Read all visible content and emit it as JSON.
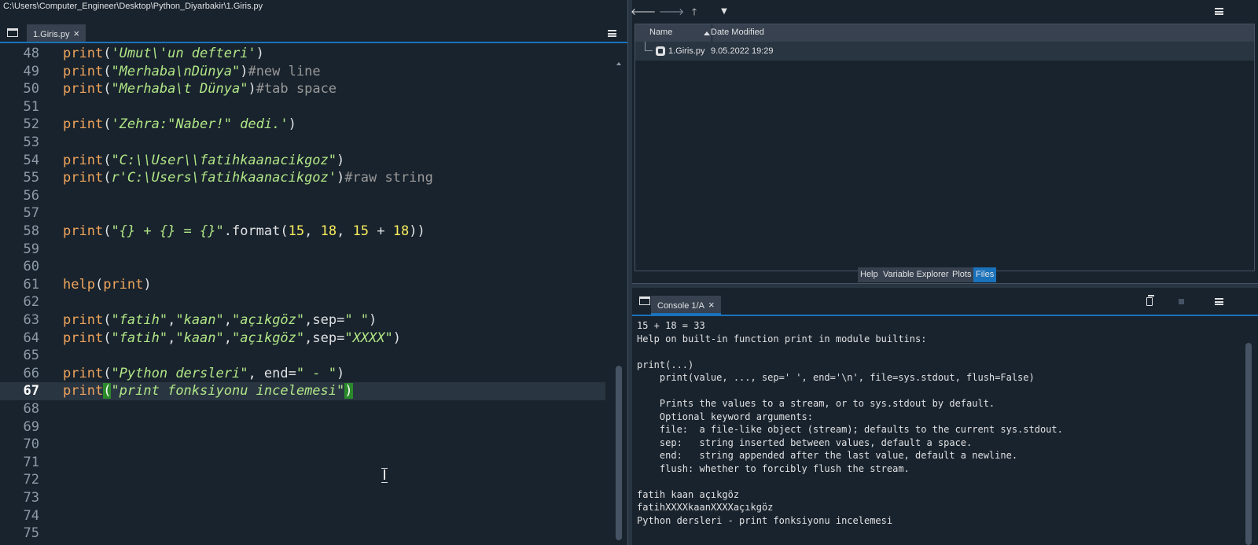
{
  "window": {
    "path": "C:\\Users\\Computer_Engineer\\Desktop\\Python_Diyarbakir\\1.Giris.py"
  },
  "editor": {
    "tab_label": "1.Giris.py",
    "tab_close": "×",
    "current_line": "67",
    "lines": [
      {
        "n": "48",
        "tokens": [
          [
            "fn",
            "print"
          ],
          [
            "op",
            "("
          ],
          [
            "st",
            "'Umut\\'un defteri'"
          ],
          [
            "op",
            ")"
          ]
        ]
      },
      {
        "n": "49",
        "tokens": [
          [
            "fn",
            "print"
          ],
          [
            "op",
            "("
          ],
          [
            "st",
            "\"Merhaba\\nDünya\""
          ],
          [
            "op",
            ")"
          ],
          [
            "cm",
            "#new line"
          ]
        ]
      },
      {
        "n": "50",
        "tokens": [
          [
            "fn",
            "print"
          ],
          [
            "op",
            "("
          ],
          [
            "st",
            "\"Merhaba\\t Dünya\""
          ],
          [
            "op",
            ")"
          ],
          [
            "cm",
            "#tab space"
          ]
        ]
      },
      {
        "n": "51",
        "tokens": []
      },
      {
        "n": "52",
        "tokens": [
          [
            "fn",
            "print"
          ],
          [
            "op",
            "("
          ],
          [
            "st",
            "'Zehra:\"Naber!\" dedi.'"
          ],
          [
            "op",
            ")"
          ]
        ]
      },
      {
        "n": "53",
        "tokens": []
      },
      {
        "n": "54",
        "tokens": [
          [
            "fn",
            "print"
          ],
          [
            "op",
            "("
          ],
          [
            "st",
            "\"C:\\\\User\\\\fatihkaanacikgoz\""
          ],
          [
            "op",
            ")"
          ]
        ]
      },
      {
        "n": "55",
        "tokens": [
          [
            "fn",
            "print"
          ],
          [
            "op",
            "("
          ],
          [
            "st",
            "r'C:\\Users\\fatihkaanacikgoz'"
          ],
          [
            "op",
            ")"
          ],
          [
            "cm",
            "#raw string"
          ]
        ]
      },
      {
        "n": "56",
        "tokens": []
      },
      {
        "n": "57",
        "tokens": []
      },
      {
        "n": "58",
        "tokens": [
          [
            "fn",
            "print"
          ],
          [
            "op",
            "("
          ],
          [
            "st",
            "\"{} + {} = {}\""
          ],
          [
            "op",
            ".format("
          ],
          [
            "nm",
            "15"
          ],
          [
            "op",
            ", "
          ],
          [
            "nm",
            "18"
          ],
          [
            "op",
            ", "
          ],
          [
            "nm",
            "15"
          ],
          [
            "op",
            " + "
          ],
          [
            "nm",
            "18"
          ],
          [
            "op",
            "))"
          ]
        ]
      },
      {
        "n": "59",
        "tokens": []
      },
      {
        "n": "60",
        "tokens": []
      },
      {
        "n": "61",
        "tokens": [
          [
            "fn",
            "help"
          ],
          [
            "op",
            "("
          ],
          [
            "fn",
            "print"
          ],
          [
            "op",
            ")"
          ]
        ]
      },
      {
        "n": "62",
        "tokens": []
      },
      {
        "n": "63",
        "tokens": [
          [
            "fn",
            "print"
          ],
          [
            "op",
            "("
          ],
          [
            "st",
            "\"fatih\""
          ],
          [
            "op",
            ","
          ],
          [
            "st",
            "\"kaan\""
          ],
          [
            "op",
            ","
          ],
          [
            "st",
            "\"açıkgöz\""
          ],
          [
            "op",
            ",sep="
          ],
          [
            "st",
            "\" \""
          ],
          [
            "op",
            ")"
          ]
        ]
      },
      {
        "n": "64",
        "tokens": [
          [
            "fn",
            "print"
          ],
          [
            "op",
            "("
          ],
          [
            "st",
            "\"fatih\""
          ],
          [
            "op",
            ","
          ],
          [
            "st",
            "\"kaan\""
          ],
          [
            "op",
            ","
          ],
          [
            "st",
            "\"açıkgöz\""
          ],
          [
            "op",
            ",sep="
          ],
          [
            "st",
            "\"XXXX\""
          ],
          [
            "op",
            ")"
          ]
        ]
      },
      {
        "n": "65",
        "tokens": []
      },
      {
        "n": "66",
        "tokens": [
          [
            "fn",
            "print"
          ],
          [
            "op",
            "("
          ],
          [
            "st",
            "\"Python dersleri\""
          ],
          [
            "op",
            ", end="
          ],
          [
            "st",
            "\" - \""
          ],
          [
            "op",
            ")"
          ]
        ]
      },
      {
        "n": "67",
        "tokens": [
          [
            "fn",
            "print"
          ],
          [
            "br",
            "("
          ],
          [
            "st",
            "\"print fonksiyonu incelemesi\""
          ],
          [
            "br",
            ")"
          ]
        ]
      },
      {
        "n": "68",
        "tokens": []
      },
      {
        "n": "69",
        "tokens": []
      },
      {
        "n": "70",
        "tokens": []
      },
      {
        "n": "71",
        "tokens": []
      },
      {
        "n": "72",
        "tokens": []
      },
      {
        "n": "73",
        "tokens": []
      },
      {
        "n": "74",
        "tokens": []
      },
      {
        "n": "75",
        "tokens": []
      }
    ]
  },
  "files": {
    "toolbar_icons": [
      "back-arrow-icon",
      "forward-arrow-icon",
      "parent-directory-icon",
      "filter-icon",
      "options-menu-icon"
    ],
    "toolbar_glyphs": {
      "back": "🡐",
      "forward": "🡒",
      "up": "🡑",
      "filter": "▼"
    },
    "columns": {
      "name": "Name",
      "date": "Date Modified"
    },
    "rows": [
      {
        "name": "1.Giris.py",
        "date": "9.05.2022 19:29"
      }
    ]
  },
  "bottom_tabs": [
    {
      "label": "Help",
      "active": false
    },
    {
      "label": "Variable Explorer",
      "active": false
    },
    {
      "label": "Plots",
      "active": false
    },
    {
      "label": "Files",
      "active": true
    }
  ],
  "console": {
    "tab_label": "Console 1/A",
    "tab_close": "×",
    "output": "15 + 18 = 33\nHelp on built-in function print in module builtins:\n\nprint(...)\n    print(value, ..., sep=' ', end='\\n', file=sys.stdout, flush=False)\n\n    Prints the values to a stream, or to sys.stdout by default.\n    Optional keyword arguments:\n    file:  a file-like object (stream); defaults to the current sys.stdout.\n    sep:   string inserted between values, default a space.\n    end:   string appended after the last value, default a newline.\n    flush: whether to forcibly flush the stream.\n\nfatih kaan açıkgöz\nfatihXXXXkaanXXXXaçıkgöz\nPython dersleri - print fonksiyonu incelemesi"
  },
  "colors": {
    "background": "#19232d",
    "accent": "#1a72bb",
    "function": "#f0a55c",
    "string": "#b0e686",
    "number": "#faed5c",
    "comment": "#999999",
    "bracket_match": "#2a8a2a"
  }
}
